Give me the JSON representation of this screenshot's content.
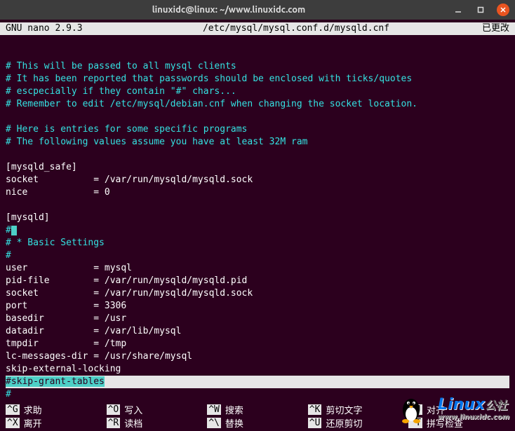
{
  "titlebar": {
    "title": "linuxidc@linux: ~/www.linuxidc.com"
  },
  "nano": {
    "version": "GNU nano 2.9.3",
    "file": "/etc/mysql/mysql.conf.d/mysqld.cnf",
    "status": "已更改"
  },
  "lines": {
    "c1": "# This will be passed to all mysql clients",
    "c2": "# It has been reported that passwords should be enclosed with ticks/quotes",
    "c3": "# escpecially if they contain \"#\" chars...",
    "c4": "# Remember to edit /etc/mysql/debian.cnf when changing the socket location.",
    "c5": "# Here is entries for some specific programs",
    "c6": "# The following values assume you have at least 32M ram",
    "s1": "[mysqld_safe]",
    "s2": "socket          = /var/run/mysqld/mysqld.sock",
    "s3": "nice            = 0",
    "s4": "[mysqld]",
    "h1": "#",
    "h2": "# * Basic Settings",
    "h3": "#",
    "p_user": "user            = mysql",
    "p_pid": "pid-file        = /var/run/mysqld/mysqld.pid",
    "p_socket": "socket          = /var/run/mysqld/mysqld.sock",
    "p_port": "port            = 3306",
    "p_basedir": "basedir         = /usr",
    "p_datadir": "datadir         = /var/lib/mysql",
    "p_tmpdir": "tmpdir          = /tmp",
    "p_lcmsg": "lc-messages-dir = /usr/share/mysql",
    "p_skipext": "skip-external-locking",
    "hl_skip": "#skip-grant-tables",
    "h4": "#"
  },
  "shortcuts": {
    "r1": [
      {
        "key": "^G",
        "label": "求助"
      },
      {
        "key": "^O",
        "label": "写入"
      },
      {
        "key": "^W",
        "label": "搜索"
      },
      {
        "key": "^K",
        "label": "剪切文字"
      },
      {
        "key": "^J",
        "label": "对齐"
      }
    ],
    "r2": [
      {
        "key": "^X",
        "label": "离开"
      },
      {
        "key": "^R",
        "label": "读档"
      },
      {
        "key": "^\\",
        "label": "替换"
      },
      {
        "key": "^U",
        "label": "还原剪切"
      },
      {
        "key": "^T",
        "label": "拼写检查"
      }
    ]
  },
  "watermark": {
    "brand": "Linux",
    "cn": "公社",
    "url": "www.linuxidc.com"
  }
}
